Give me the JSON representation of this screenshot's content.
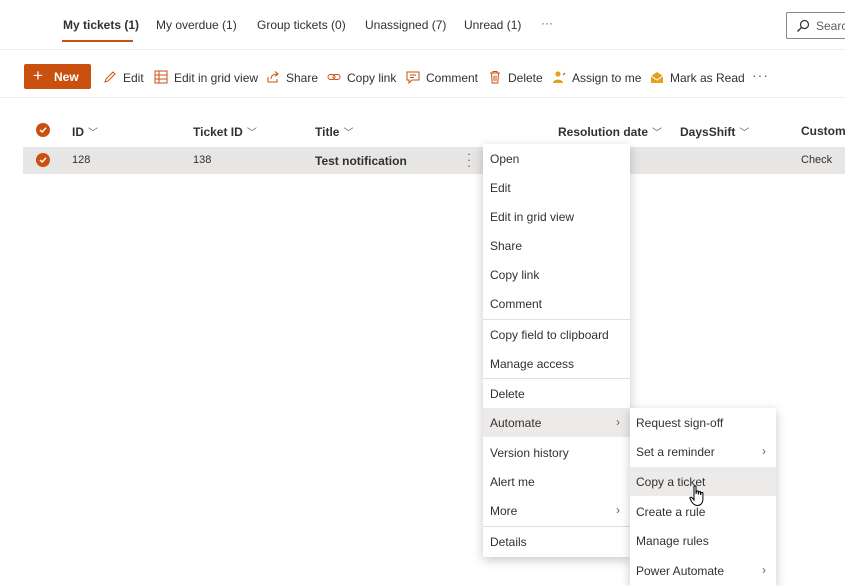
{
  "tabs": [
    {
      "label": "My tickets (1)",
      "active": true
    },
    {
      "label": "My overdue (1)"
    },
    {
      "label": "Group tickets (0)"
    },
    {
      "label": "Unassigned (7)"
    },
    {
      "label": "Unread (1)"
    }
  ],
  "tabs_more": "···",
  "search": {
    "placeholder": "Search"
  },
  "commands": {
    "new": "New",
    "edit": "Edit",
    "edit_grid": "Edit in grid view",
    "share": "Share",
    "copy_link": "Copy link",
    "comment": "Comment",
    "delete": "Delete",
    "assign": "Assign to me",
    "mark_read": "Mark as Read",
    "more": "···"
  },
  "columns": [
    "ID",
    "Ticket ID",
    "Title",
    "Resolution date",
    "DaysShift",
    "CustomF"
  ],
  "rows": [
    {
      "id": "128",
      "ticket_id": "138",
      "title": "Test notification",
      "custom": "Check"
    }
  ],
  "context_menu": [
    "Open",
    "Edit",
    "Edit in grid view",
    "Share",
    "Copy link",
    "Comment",
    "Copy field to clipboard",
    "Manage access",
    "Delete",
    "Automate",
    "Version history",
    "Alert me",
    "More",
    "Details"
  ],
  "submenu": [
    "Request sign-off",
    "Set a reminder",
    "Copy a ticket",
    "Create a rule",
    "Manage rules",
    "Power Automate"
  ],
  "colors": {
    "accent": "#ca5010",
    "selected_row": "#e8e6e4",
    "hover": "#edebe9"
  }
}
